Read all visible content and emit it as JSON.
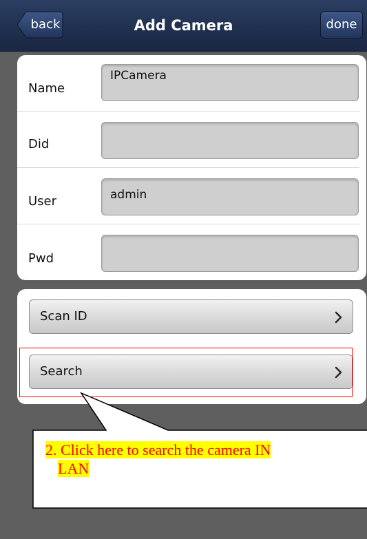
{
  "nav": {
    "title": "Add Camera",
    "back_label": "back",
    "done_label": "done"
  },
  "form": {
    "fields": [
      {
        "label": "Name",
        "value": "IPCamera"
      },
      {
        "label": "Did",
        "value": ""
      },
      {
        "label": "User",
        "value": "admin"
      },
      {
        "label": "Pwd",
        "value": ""
      }
    ]
  },
  "actions": {
    "scan_id_label": "Scan ID",
    "search_label": "Search"
  },
  "annotation": {
    "number": "2.",
    "line1": "Click here to search the camera IN",
    "line2": "LAN",
    "text_color": "#ff0000",
    "highlight_color": "#ffff00",
    "box_color": "#ff0000"
  },
  "colors": {
    "nav_bar": "#22345a",
    "background": "#5f5f5f",
    "card": "#ffffff",
    "input_fill": "#cfcfcf"
  },
  "icons": {
    "action_chevron": "chevron-right-icon",
    "back_shape": "back-arrow-button"
  }
}
